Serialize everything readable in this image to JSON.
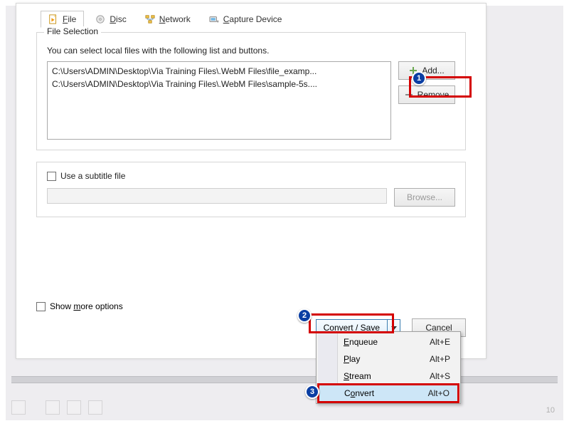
{
  "tabs": {
    "file": "File",
    "disc": "Disc",
    "network": "Network",
    "capture": "Capture Device"
  },
  "file_selection": {
    "title": "File Selection",
    "desc": "You can select local files with the following list and buttons.",
    "files": [
      "C:\\Users\\ADMIN\\Desktop\\Via Training Files\\.WebM Files\\file_examp...",
      "C:\\Users\\ADMIN\\Desktop\\Via Training Files\\.WebM Files\\sample-5s...."
    ],
    "add": "Add...",
    "remove": "Remove"
  },
  "subtitle": {
    "checkbox": "Use a subtitle file",
    "browse": "Browse..."
  },
  "more_options": "Show more options",
  "footer": {
    "convert_save": "Convert / Save",
    "cancel": "Cancel"
  },
  "menu": {
    "enqueue": {
      "label": "Enqueue",
      "shortcut": "Alt+E"
    },
    "play": {
      "label": "Play",
      "shortcut": "Alt+P"
    },
    "stream": {
      "label": "Stream",
      "shortcut": "Alt+S"
    },
    "convert": {
      "label": "Convert",
      "shortcut": "Alt+O"
    }
  },
  "annotations": {
    "b1": "1",
    "b2": "2",
    "b3": "3"
  },
  "pagenum": "10"
}
